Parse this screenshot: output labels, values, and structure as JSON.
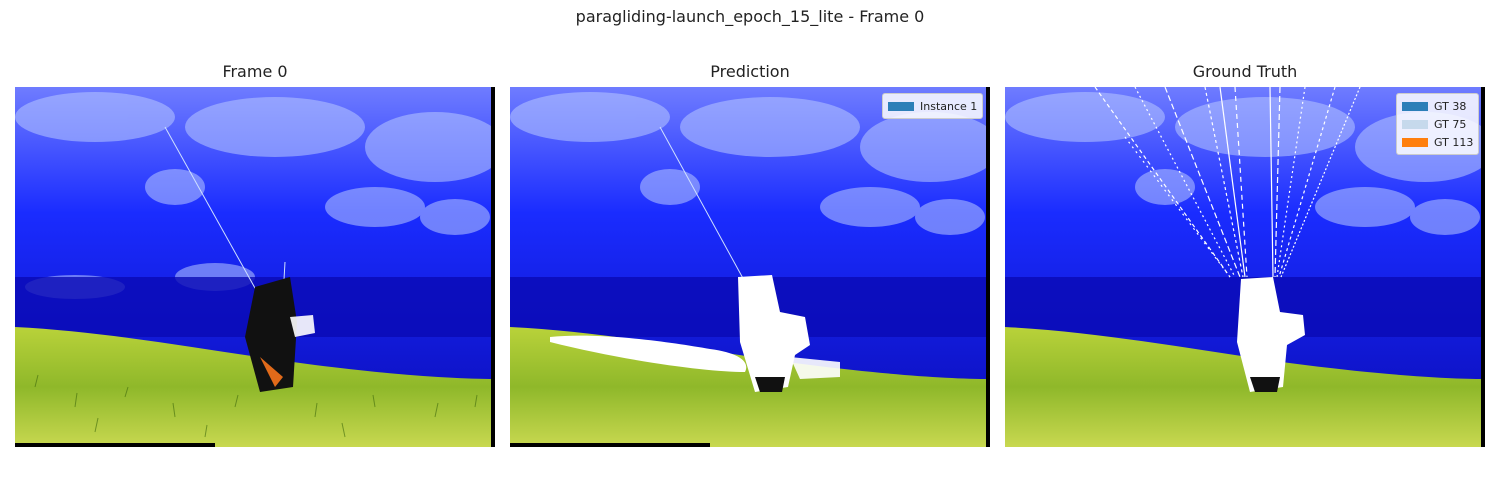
{
  "figure": {
    "title": "paragliding-launch_epoch_15_lite - Frame 0"
  },
  "panels": [
    {
      "title": "Frame 0"
    },
    {
      "title": "Prediction",
      "legend": [
        {
          "label": "Instance 1",
          "color": "#2c7fb8"
        }
      ]
    },
    {
      "title": "Ground Truth",
      "legend": [
        {
          "label": "GT 38",
          "color": "#2c7fb8"
        },
        {
          "label": "GT 75",
          "color": "#c6d9ec"
        },
        {
          "label": "GT 113",
          "color": "#ff7f0e"
        }
      ]
    }
  ],
  "colors": {
    "sky_blue": "#1a2cff",
    "valley_blue": "#0b16d8",
    "lake_blue": "#0a0ab4",
    "grass_yellow": "#9bbe2a",
    "grass_dark": "#4e7a12",
    "mask_white": "#ffffff",
    "pilot_black": "#111111"
  }
}
